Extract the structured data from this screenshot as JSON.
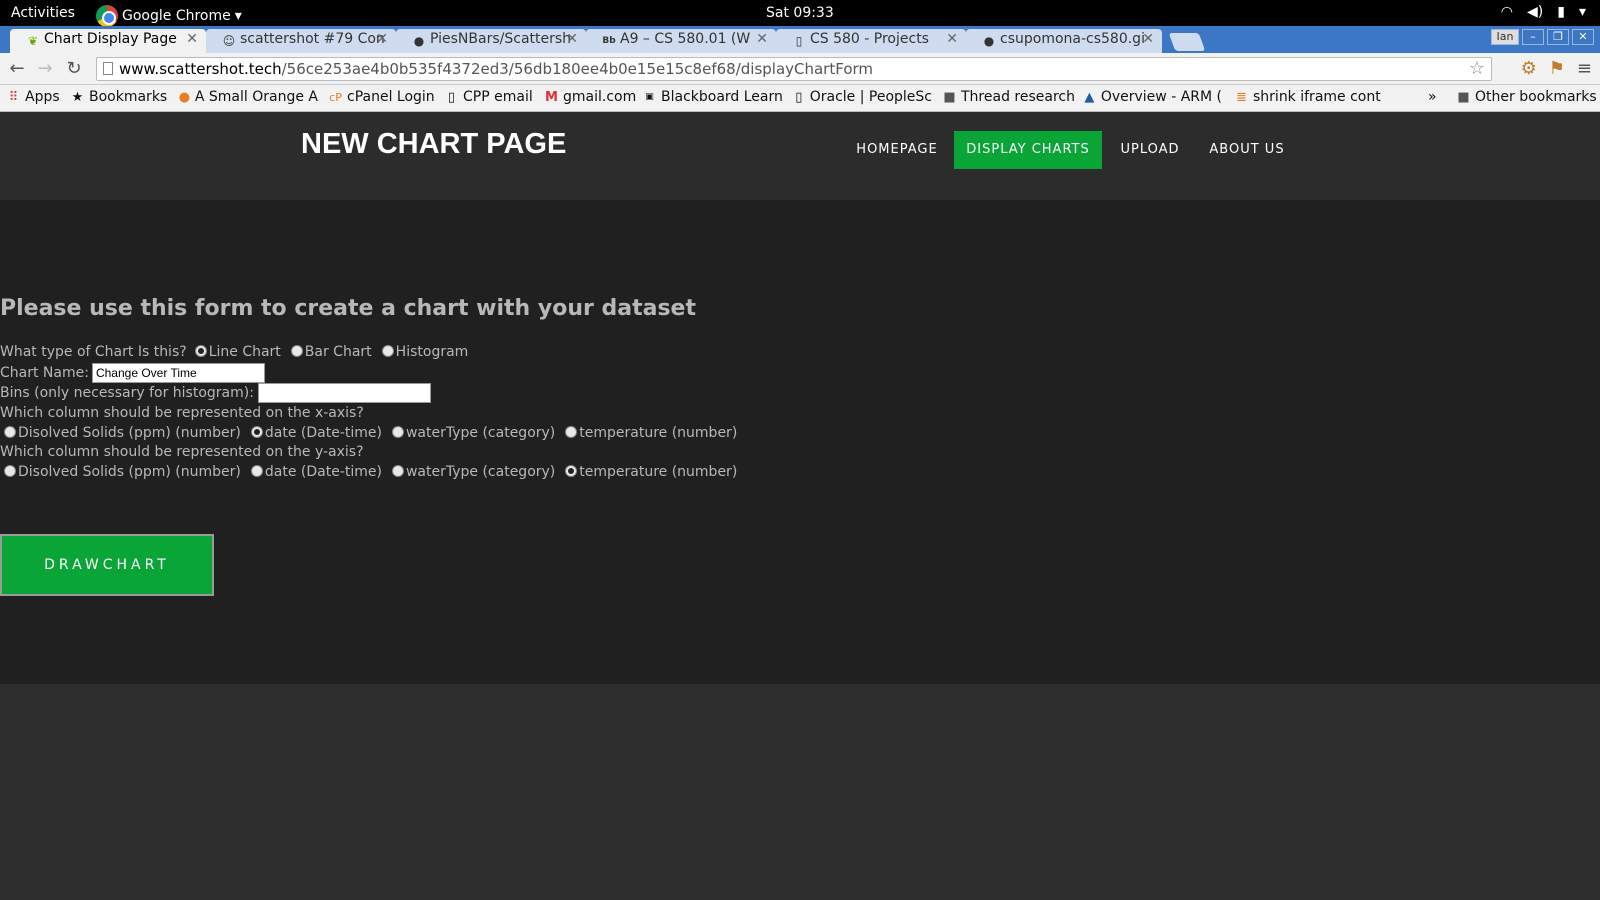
{
  "system": {
    "activities": "Activities",
    "app_name": "Google Chrome",
    "clock": "Sat 09:33"
  },
  "tabs": [
    {
      "title": "Chart Display Page",
      "icon": "leaf-icon"
    },
    {
      "title": "scattershot #79 Con",
      "icon": "person-icon"
    },
    {
      "title": "PiesNBars/Scattersh",
      "icon": "github-icon"
    },
    {
      "title": "A9 – CS 580.01 (W",
      "icon": "blackboard-icon"
    },
    {
      "title": "CS 580 - Projects",
      "icon": "page-icon"
    },
    {
      "title": "csupomona-cs580.gi",
      "icon": "github-icon"
    }
  ],
  "window": {
    "user": "Ian"
  },
  "address": {
    "host": "www.scattershot.tech",
    "path": "/56ce253ae4b0b535f4372ed3/56db180ee4b0e15e15c8ef68/displayChartForm"
  },
  "bookmarks": [
    {
      "label": "Apps",
      "icon": "apps-grid-icon"
    },
    {
      "label": "Bookmarks",
      "icon": "star-icon"
    },
    {
      "label": "A Small Orange A",
      "icon": "orange-icon"
    },
    {
      "label": "cPanel Login",
      "icon": "cpanel-icon"
    },
    {
      "label": "CPP email",
      "icon": "page-icon"
    },
    {
      "label": "gmail.com",
      "icon": "gmail-icon"
    },
    {
      "label": "Blackboard Learn",
      "icon": "blackboard-icon"
    },
    {
      "label": "Oracle | PeopleSc",
      "icon": "page-icon"
    },
    {
      "label": "Thread research",
      "icon": "folder-icon"
    },
    {
      "label": "Overview - ARM (",
      "icon": "arm-icon"
    },
    {
      "label": "shrink iframe cont",
      "icon": "stackoverflow-icon"
    },
    {
      "label": "»",
      "icon": ""
    },
    {
      "label": "Other bookmarks",
      "icon": "folder-icon"
    }
  ],
  "site": {
    "title": "NEW CHART PAGE",
    "nav": [
      "HOMEPAGE",
      "DISPLAY CHARTS",
      "UPLOAD",
      "ABOUT US"
    ],
    "nav_active": "DISPLAY CHARTS",
    "accent_color": "#0aa537"
  },
  "form": {
    "heading": "Please use this form to create a chart with your dataset",
    "type_label": "What type of Chart Is this?",
    "type_options": [
      "Line Chart",
      "Bar Chart",
      "Histogram"
    ],
    "type_selected": "Line Chart",
    "name_label": "Chart Name:",
    "name_value": "Change Over Time",
    "bins_label": "Bins (only necessary for histogram):",
    "bins_value": "",
    "x_label": "Which column should be represented on the x-axis?",
    "y_label": "Which column should be represented on the y-axis?",
    "columns": [
      "Disolved Solids (ppm) (number)",
      "date (Date-time)",
      "waterType (category)",
      "temperature (number)"
    ],
    "x_selected": "date (Date-time)",
    "y_selected": "temperature (number)",
    "submit_label": "DRAWCHART"
  }
}
